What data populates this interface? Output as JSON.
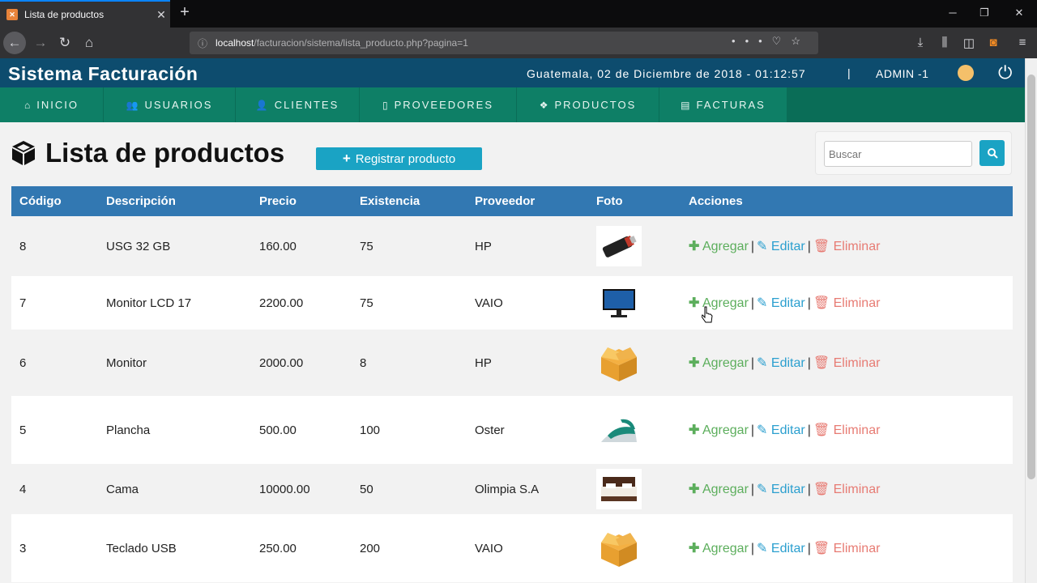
{
  "browser": {
    "tab_title": "Lista de productos",
    "url_host": "localhost",
    "url_path": "/facturacion/sistema/lista_producto.php?pagina=1"
  },
  "header": {
    "brand": "Sistema Facturación",
    "datetime": "Guatemala, 02 de Diciembre de 2018 - 01:12:57",
    "separator": "|",
    "user": "ADMIN -1"
  },
  "menu": [
    {
      "label": "INICIO",
      "icon": "home-icon",
      "glyph": "⌂"
    },
    {
      "label": "USUARIOS",
      "icon": "users-icon",
      "glyph": "👥"
    },
    {
      "label": "CLIENTES",
      "icon": "user-icon",
      "glyph": "👤"
    },
    {
      "label": "PROVEEDORES",
      "icon": "building-icon",
      "glyph": "▯"
    },
    {
      "label": "PRODUCTOS",
      "icon": "cubes-icon",
      "glyph": "❖"
    },
    {
      "label": "FACTURAS",
      "icon": "file-icon",
      "glyph": "▤"
    }
  ],
  "page": {
    "title": "Lista de productos",
    "register_button": "Registrar producto",
    "search_placeholder": "Buscar"
  },
  "table": {
    "headers": [
      "Código",
      "Descripción",
      "Precio",
      "Existencia",
      "Proveedor",
      "Foto",
      "Acciones"
    ],
    "actions": {
      "add": "Agregar",
      "edit": "Editar",
      "delete": "Eliminar",
      "sep": "|"
    },
    "rows": [
      {
        "codigo": "8",
        "descripcion": "USG 32 GB",
        "precio": "160.00",
        "existencia": "75",
        "proveedor": "HP",
        "foto": "usb-drive-icon"
      },
      {
        "codigo": "7",
        "descripcion": "Monitor LCD 17",
        "precio": "2200.00",
        "existencia": "75",
        "proveedor": "VAIO",
        "foto": "monitor-icon"
      },
      {
        "codigo": "6",
        "descripcion": "Monitor",
        "precio": "2000.00",
        "existencia": "8",
        "proveedor": "HP",
        "foto": "box-icon"
      },
      {
        "codigo": "5",
        "descripcion": "Plancha",
        "precio": "500.00",
        "existencia": "100",
        "proveedor": "Oster",
        "foto": "iron-icon"
      },
      {
        "codigo": "4",
        "descripcion": "Cama",
        "precio": "10000.00",
        "existencia": "50",
        "proveedor": "Olimpia S.A",
        "foto": "bed-icon"
      },
      {
        "codigo": "3",
        "descripcion": "Teclado USB",
        "precio": "250.00",
        "existencia": "200",
        "proveedor": "VAIO",
        "foto": "box-icon"
      }
    ]
  },
  "colors": {
    "header_bg": "#0d4c6e",
    "menu_bg": "#0e7f66",
    "table_header": "#3278b2",
    "primary_button": "#1aa3c4",
    "add": "#5cae5c",
    "edit": "#2b9fcf",
    "delete": "#e77b73"
  }
}
